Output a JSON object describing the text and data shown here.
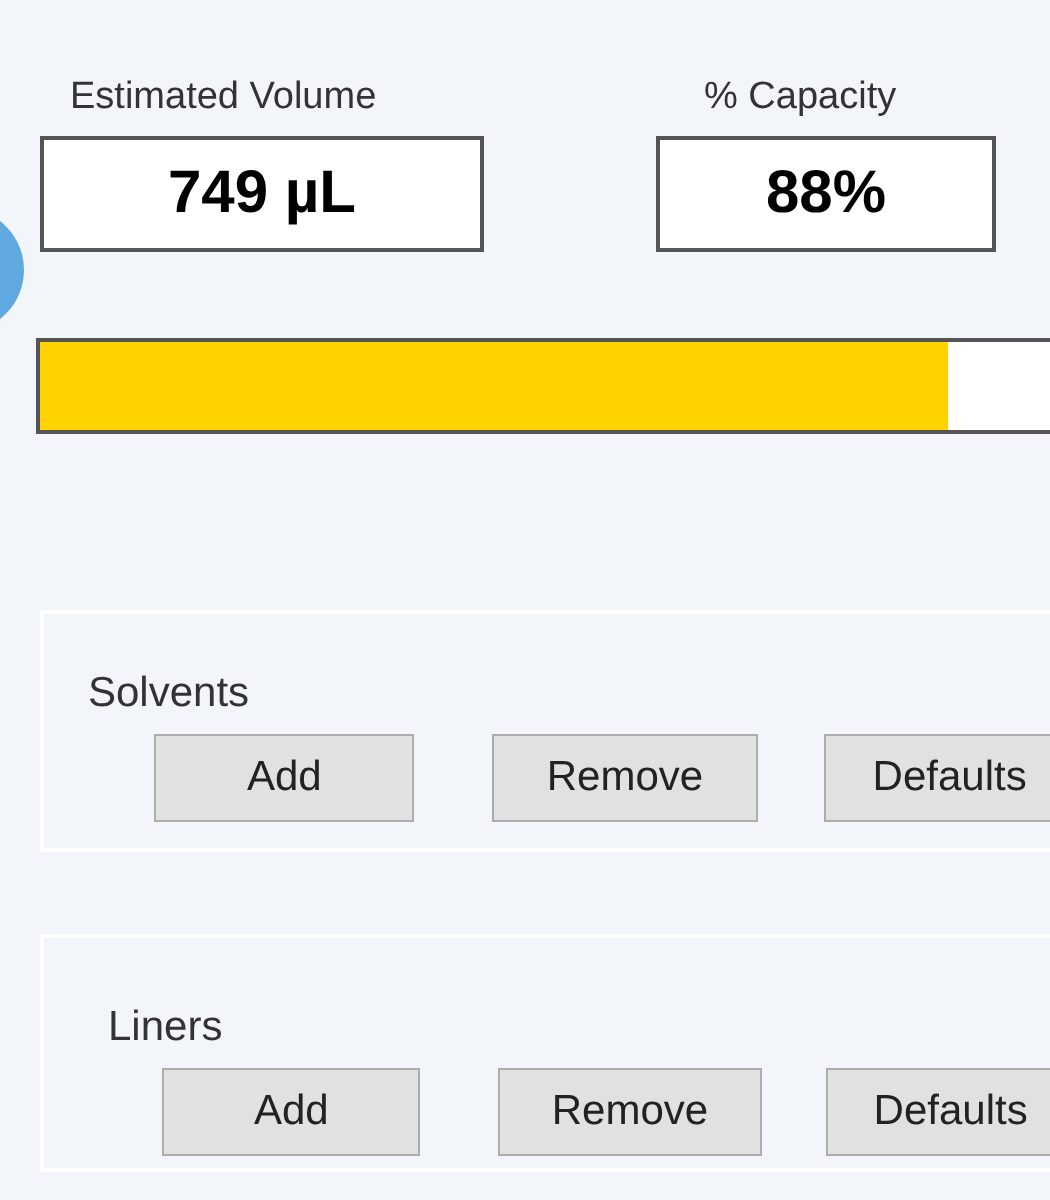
{
  "readouts": [
    {
      "label": "Estimated Volume",
      "value": "749 µL"
    },
    {
      "label": "% Capacity",
      "value": "88%"
    }
  ],
  "progress": {
    "level": 0.88
  },
  "groups": [
    {
      "title": "Solvents",
      "buttons": [
        "Add",
        "Remove",
        "Defaults"
      ]
    },
    {
      "title": "Liners",
      "buttons": [
        "Add",
        "Remove",
        "Defaults"
      ]
    }
  ]
}
